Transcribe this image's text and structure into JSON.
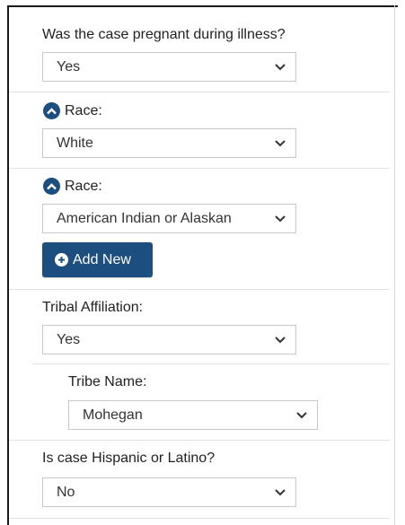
{
  "pregnant": {
    "label": "Was the case pregnant during illness?",
    "value": "Yes"
  },
  "race1": {
    "label": "Race:",
    "value": "White"
  },
  "race2": {
    "label": "Race:",
    "value": "American Indian or Alaskan"
  },
  "add_new": {
    "label": "Add New"
  },
  "tribal": {
    "label": "Tribal Affiliation:",
    "value": "Yes"
  },
  "tribe_name": {
    "label": "Tribe Name:",
    "value": "Mohegan"
  },
  "hispanic": {
    "label": "Is case Hispanic or Latino?",
    "value": "No"
  },
  "colors": {
    "accent": "#1c4e80",
    "border": "#c8c8c8",
    "divider": "#e3e3e3"
  }
}
